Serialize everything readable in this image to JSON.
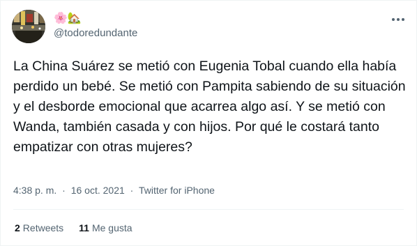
{
  "author": {
    "display_name": "🌸🏡",
    "handle": "@todoredundante"
  },
  "tweet": {
    "text": "La China Suárez se metió con Eugenia Tobal cuando ella había perdido un bebé. Se metió con Pampita sabiendo de su situación y el desborde emocional que acarrea algo así. Y se metió con Wanda, también casada y con hijos. Por qué le costará tanto empatizar con otras mujeres?",
    "time": "4:38 p. m.",
    "separator": "·",
    "date": "16 oct. 2021",
    "source": "Twitter for iPhone"
  },
  "stats": {
    "retweets_count": "2",
    "retweets_label": "Retweets",
    "likes_count": "11",
    "likes_label": "Me gusta"
  },
  "icons": {
    "more": "more-options-icon"
  },
  "colors": {
    "text": "#0f1419",
    "secondary": "#536471",
    "divider": "#eff3f4"
  }
}
